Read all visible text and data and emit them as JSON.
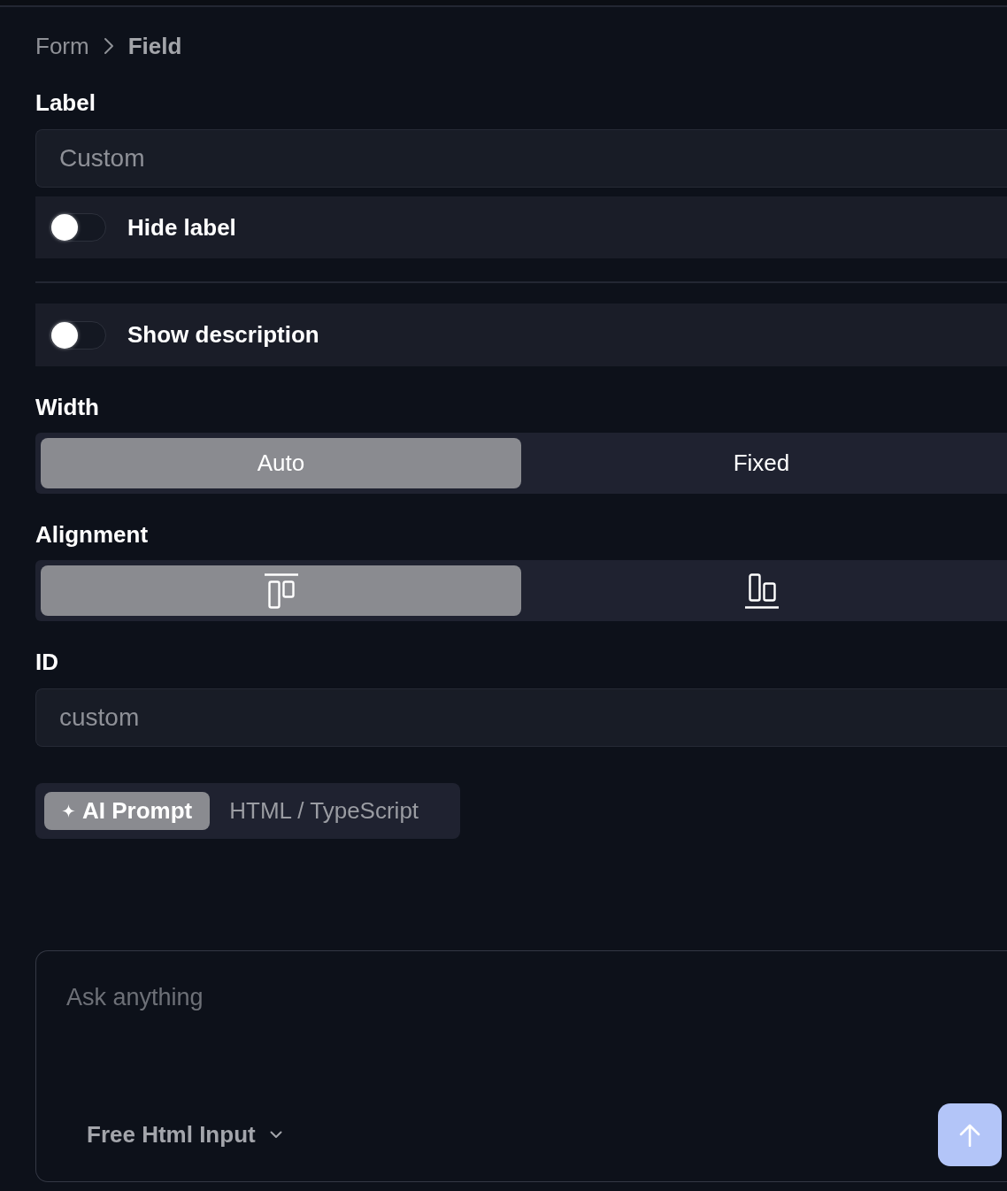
{
  "breadcrumb": [
    {
      "label": "Form",
      "current": false
    },
    {
      "label": "Field",
      "current": true
    }
  ],
  "label_field": {
    "label": "Label",
    "value": "Custom"
  },
  "display_toggles": [
    {
      "label": "Hide label",
      "on": false
    },
    {
      "label": "Show description",
      "on": false
    }
  ],
  "width": {
    "label": "Width",
    "options": [
      {
        "label": "Auto",
        "selected": true
      },
      {
        "label": "Fixed",
        "selected": false
      }
    ]
  },
  "alignment": {
    "label": "Alignment",
    "options": [
      {
        "kind": "top",
        "selected": true
      },
      {
        "kind": "bottom",
        "selected": false
      }
    ]
  },
  "id_field": {
    "label": "ID",
    "value": "custom"
  },
  "mode_tabs": [
    {
      "kind": "ai",
      "label": "AI Prompt",
      "selected": true
    },
    {
      "kind": "code",
      "label": "HTML / TypeScript",
      "selected": false
    }
  ],
  "prompt": {
    "placeholder": "Ask anything",
    "model": "Free Html Input"
  }
}
